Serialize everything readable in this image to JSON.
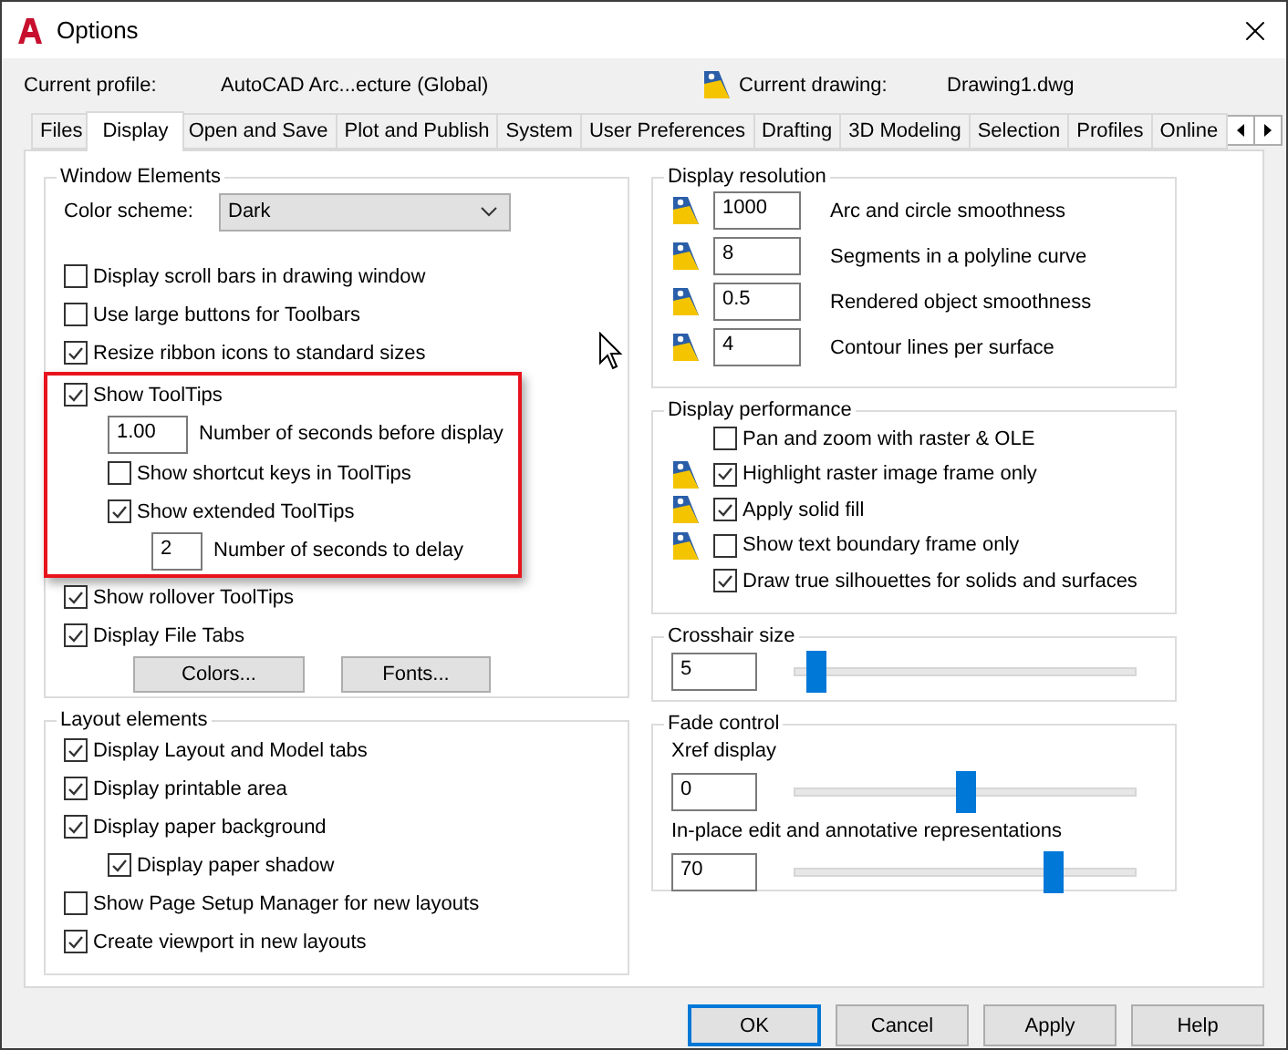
{
  "window": {
    "title": "Options"
  },
  "profile": {
    "label": "Current profile:",
    "value": "AutoCAD Arc...ecture (Global)",
    "drawing_label": "Current drawing:",
    "drawing_value": "Drawing1.dwg"
  },
  "tabs": [
    {
      "label": "Files",
      "selected": false
    },
    {
      "label": "Display",
      "selected": true
    },
    {
      "label": "Open and Save",
      "selected": false
    },
    {
      "label": "Plot and Publish",
      "selected": false
    },
    {
      "label": "System",
      "selected": false
    },
    {
      "label": "User Preferences",
      "selected": false
    },
    {
      "label": "Drafting",
      "selected": false
    },
    {
      "label": "3D Modeling",
      "selected": false
    },
    {
      "label": "Selection",
      "selected": false
    },
    {
      "label": "Profiles",
      "selected": false
    },
    {
      "label": "Online",
      "selected": false
    }
  ],
  "window_elements": {
    "title": "Window Elements",
    "color_scheme": {
      "label": "Color scheme:",
      "value": "Dark"
    },
    "items": [
      {
        "kind": "checkbox",
        "label": "Display scroll bars in drawing window",
        "checked": false
      },
      {
        "kind": "checkbox",
        "label": "Use large buttons for Toolbars",
        "checked": false
      },
      {
        "kind": "checkbox",
        "label": "Resize ribbon icons to standard sizes",
        "checked": true
      },
      {
        "kind": "checkbox",
        "label": "Show ToolTips",
        "checked": true,
        "highlighted": true,
        "children": [
          {
            "kind": "number",
            "value": "1.00",
            "label": "Number of seconds before display"
          },
          {
            "kind": "checkbox",
            "label": "Show shortcut keys in ToolTips",
            "checked": false
          },
          {
            "kind": "checkbox",
            "label": "Show extended ToolTips",
            "checked": true,
            "children": [
              {
                "kind": "number",
                "value": "2",
                "label": "Number of seconds to delay"
              }
            ]
          }
        ]
      },
      {
        "kind": "checkbox",
        "label": "Show rollover ToolTips",
        "checked": true
      },
      {
        "kind": "checkbox",
        "label": "Display File Tabs",
        "checked": true
      }
    ],
    "buttons": [
      "Colors...",
      "Fonts..."
    ]
  },
  "layout_elements": {
    "title": "Layout elements",
    "items": [
      {
        "kind": "checkbox",
        "label": "Display Layout and Model tabs",
        "checked": true
      },
      {
        "kind": "checkbox",
        "label": "Display printable area",
        "checked": true
      },
      {
        "kind": "checkbox",
        "label": "Display paper background",
        "checked": true,
        "children": [
          {
            "kind": "checkbox",
            "label": "Display paper shadow",
            "checked": true
          }
        ]
      },
      {
        "kind": "checkbox",
        "label": "Show Page Setup Manager for new layouts",
        "checked": false
      },
      {
        "kind": "checkbox",
        "label": "Create viewport in new layouts",
        "checked": true
      }
    ]
  },
  "display_resolution": {
    "title": "Display resolution",
    "rows": [
      {
        "value": "1000",
        "label": "Arc and circle smoothness"
      },
      {
        "value": "8",
        "label": "Segments in a polyline curve"
      },
      {
        "value": "0.5",
        "label": "Rendered object smoothness"
      },
      {
        "value": "4",
        "label": "Contour lines per surface"
      }
    ]
  },
  "display_performance": {
    "title": "Display performance",
    "items": [
      {
        "label": "Pan and zoom with raster & OLE",
        "checked": false,
        "saved_in_drawing": false
      },
      {
        "label": "Highlight raster image frame only",
        "checked": true,
        "saved_in_drawing": true
      },
      {
        "label": "Apply solid fill",
        "checked": true,
        "saved_in_drawing": true
      },
      {
        "label": "Show text boundary frame only",
        "checked": false,
        "saved_in_drawing": true
      },
      {
        "label": "Draw true silhouettes for solids and surfaces",
        "checked": true,
        "saved_in_drawing": false
      }
    ]
  },
  "crosshair": {
    "title": "Crosshair size",
    "value": "5",
    "level": 0.06
  },
  "fade_control": {
    "title": "Fade control",
    "sliders": [
      {
        "label": "Xref display",
        "value": "0",
        "level": 0.5
      },
      {
        "label": "In-place edit and annotative representations",
        "value": "70",
        "level": 0.76
      }
    ]
  },
  "buttons": [
    {
      "label": "OK",
      "default": true
    },
    {
      "label": "Cancel",
      "default": false
    },
    {
      "label": "Apply",
      "default": false
    },
    {
      "label": "Help",
      "default": false
    }
  ]
}
